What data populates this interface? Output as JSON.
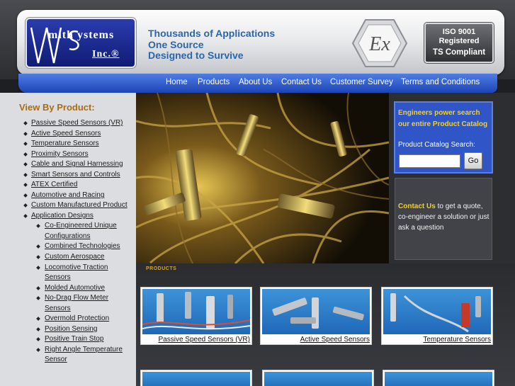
{
  "company_logo": {
    "line1": "mith ystems",
    "line2": "Inc.®"
  },
  "tagline": [
    "Thousands of Applications",
    "One Source",
    "Designed to Survive"
  ],
  "badges": {
    "ex_mark": "Ex",
    "iso": [
      "ISO 9001",
      "Registered"
    ],
    "ts": "TS Compliant"
  },
  "nav": [
    "Home",
    "Products",
    "About Us",
    "Contact Us",
    "Customer Survey",
    "Terms and Conditions"
  ],
  "sidebar": {
    "heading": "View By Product:",
    "items": [
      "Passive Speed Sensors (VR)",
      "Active Speed Sensors",
      "Temperature Sensors",
      "Proximity Sensors",
      "Cable and Signal Harnessing",
      "Smart Sensors and Controls",
      "ATEX Certified",
      "Automotive and Racing",
      "Custom Manufactured Product",
      "Application Designs"
    ],
    "subitems": [
      [
        "Co-Engineered Unique",
        "Configurations"
      ],
      [
        "Combined Technologies"
      ],
      [
        "Custom Aerospace"
      ],
      [
        "Locomotive Traction",
        "Sensors"
      ],
      [
        "Molded Automotive"
      ],
      [
        "No-Drag Flow Meter",
        "Sensors"
      ],
      [
        "Overmold Protection"
      ],
      [
        "Position Sensing"
      ],
      [
        "Positive Train Stop"
      ],
      [
        "Right Angle Temperature",
        "Sensor"
      ]
    ]
  },
  "search": {
    "promo": [
      "Engineers power search",
      "our entire Product Catalog"
    ],
    "label": "Product Catalog Search:",
    "input_value": "",
    "button": "Go"
  },
  "contact": {
    "link": "Contact Us",
    "text": " to get a quote, co-engineer a solution or just ask a question"
  },
  "products_header": "PRODUCTS",
  "products": [
    {
      "caption": "Passive Speed Sensors (VR)"
    },
    {
      "caption": "Active Speed Sensors"
    },
    {
      "caption": "Temperature Sensors"
    }
  ],
  "colors": {
    "nav_blue": "#2a55cf",
    "sidebar_heading": "#a86d10",
    "search_yellow": "#f4d21a",
    "tagline_blue": "#2b66a9"
  }
}
